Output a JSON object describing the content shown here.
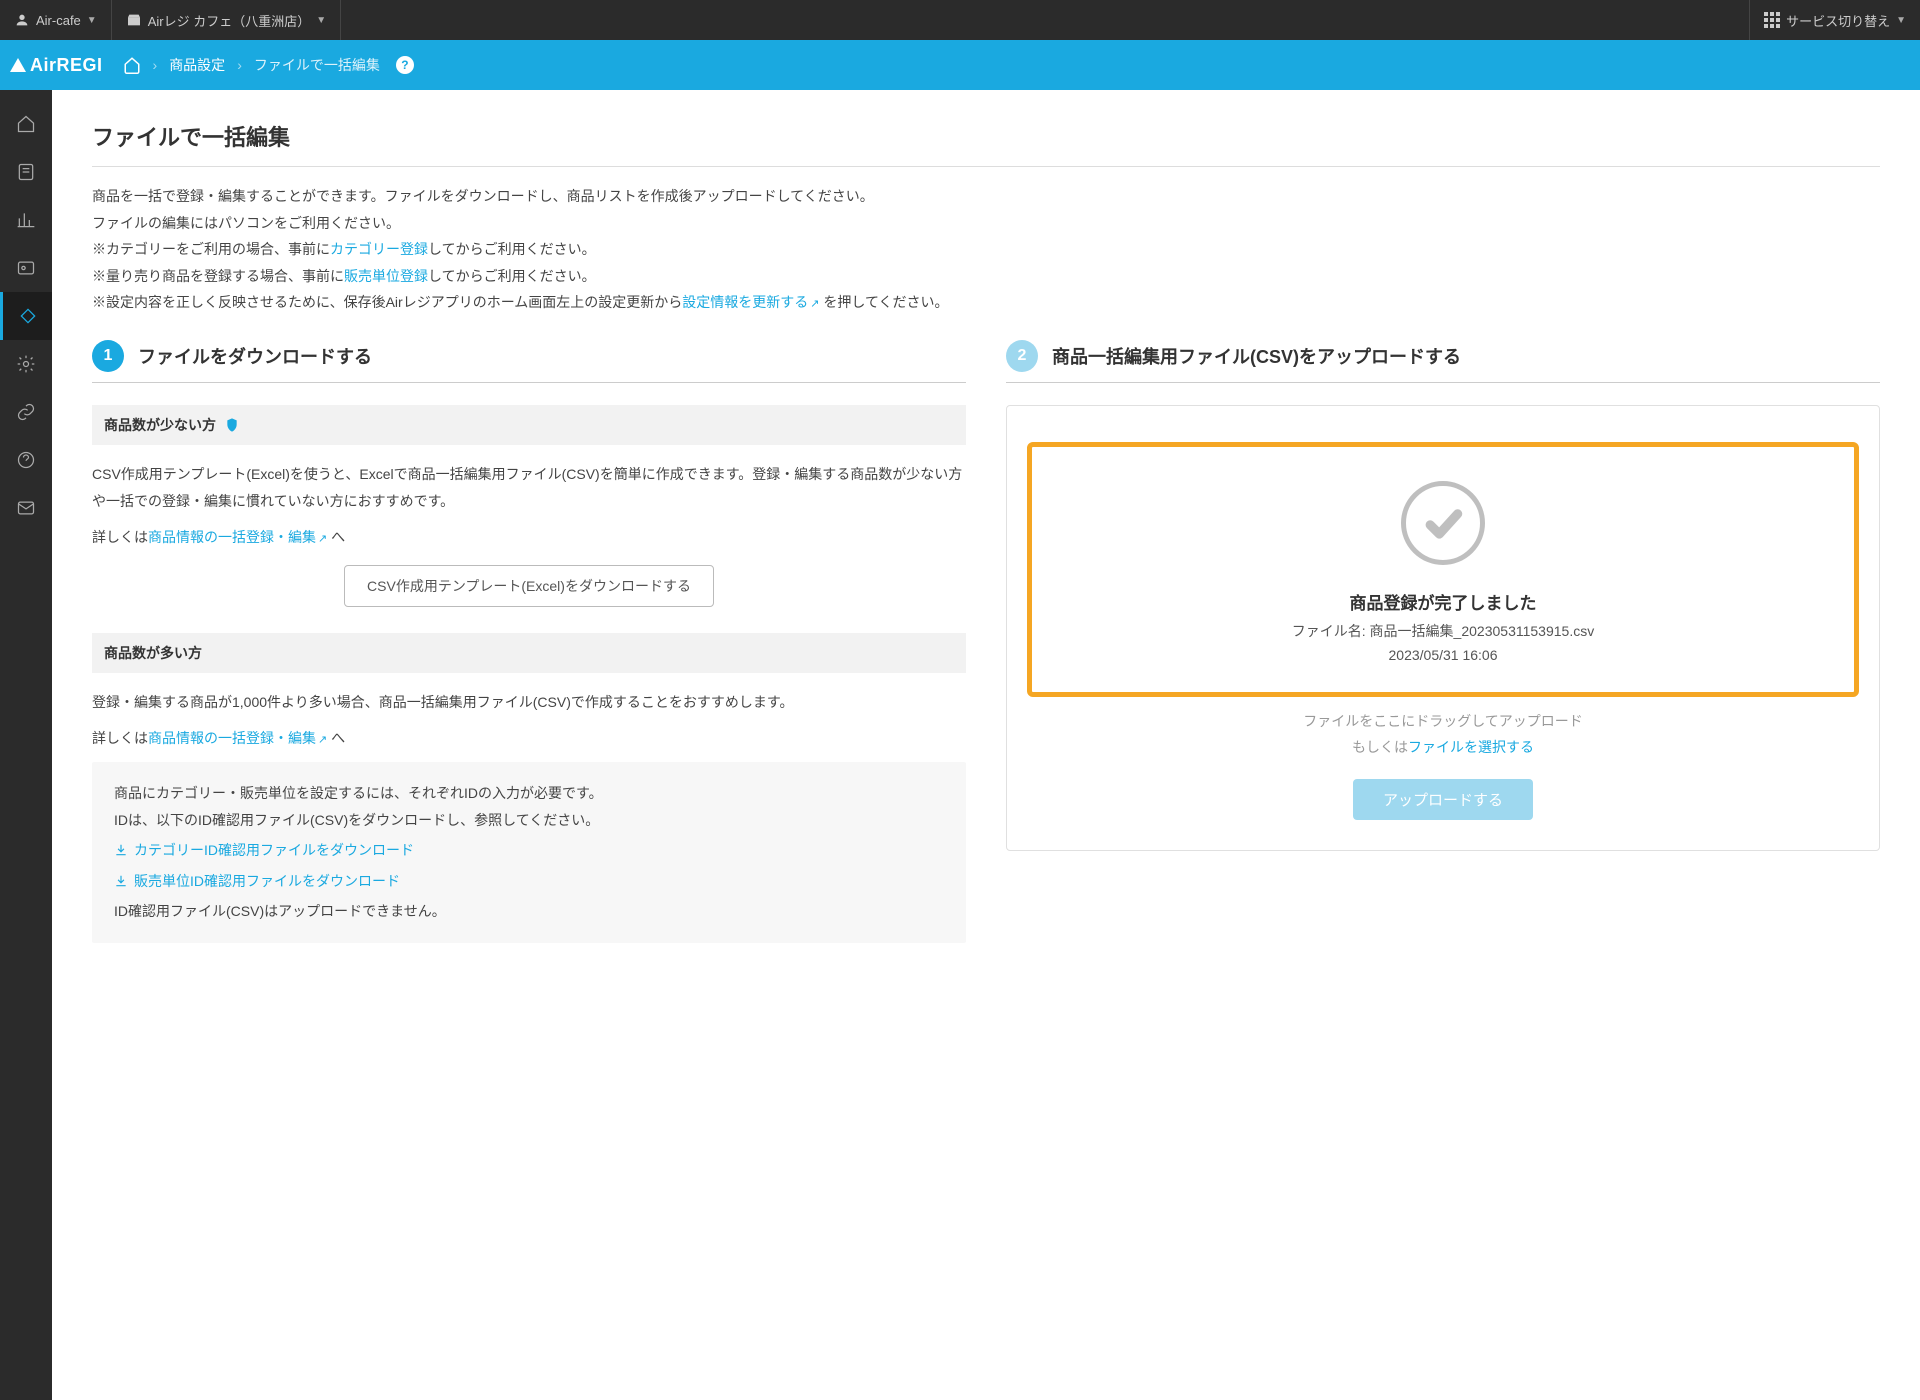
{
  "topbar": {
    "account": "Air-cafe",
    "store": "Airレジ カフェ（八重洲店）",
    "switch": "サービス切り替え"
  },
  "header": {
    "logo": "AirREGI",
    "crumb1": "商品設定",
    "crumb2": "ファイルで一括編集"
  },
  "page": {
    "title": "ファイルで一括編集",
    "intro1": "商品を一括で登録・編集することができます。ファイルをダウンロードし、商品リストを作成後アップロードしてください。",
    "intro2": "ファイルの編集にはパソコンをご利用ください。",
    "intro3a": "※カテゴリーをご利用の場合、事前に",
    "intro3link": "カテゴリー登録",
    "intro3b": "してからご利用ください。",
    "intro4a": "※量り売り商品を登録する場合、事前に",
    "intro4link": "販売単位登録",
    "intro4b": "してからご利用ください。",
    "intro5a": "※設定内容を正しく反映させるために、保存後Airレジアプリのホーム画面左上の設定更新から",
    "intro5link": "設定情報を更新する",
    "intro5b": " を押してください。"
  },
  "step1": {
    "num": "1",
    "title": "ファイルをダウンロードする",
    "sectA_label": "商品数が少ない方",
    "sectA_p1": "CSV作成用テンプレート(Excel)を使うと、Excelで商品一括編集用ファイル(CSV)を簡単に作成できます。登録・編集する商品数が少ない方や一括での登録・編集に慣れていない方におすすめです。",
    "sectA_p2a": "詳しくは",
    "sectA_p2link": "商品情報の一括登録・編集",
    "sectA_p2b": " へ",
    "sectA_btn": "CSV作成用テンプレート(Excel)をダウンロードする",
    "sectB_label": "商品数が多い方",
    "sectB_p1": "登録・編集する商品が1,000件より多い場合、商品一括編集用ファイル(CSV)で作成することをおすすめします。",
    "sectB_p2a": "詳しくは",
    "sectB_p2link": "商品情報の一括登録・編集",
    "sectB_p2b": " へ",
    "note_p1": "商品にカテゴリー・販売単位を設定するには、それぞれIDの入力が必要です。",
    "note_p2": "IDは、以下のID確認用ファイル(CSV)をダウンロードし、参照してください。",
    "note_link1": "カテゴリーID確認用ファイルをダウンロード",
    "note_link2": "販売単位ID確認用ファイルをダウンロード",
    "note_p3": "ID確認用ファイル(CSV)はアップロードできません。"
  },
  "step2": {
    "num": "2",
    "title": "商品一括編集用ファイル(CSV)をアップロードする",
    "success_title": "商品登録が完了しました",
    "success_file": "ファイル名: 商品一括編集_20230531153915.csv",
    "success_time": "2023/05/31 16:06",
    "drag1": "ファイルをここにドラッグしてアップロード",
    "drag2a": "もしくは",
    "drag2link": "ファイルを選択する",
    "upload_btn": "アップロードする"
  }
}
